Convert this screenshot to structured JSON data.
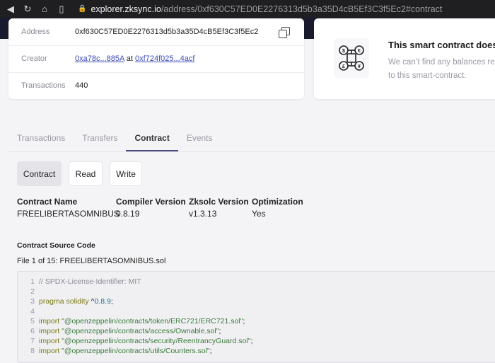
{
  "browser": {
    "url_host": "explorer.zksync.io",
    "url_path": "/address/0xf630C57ED0E2276313d5b3a35D4cB5Ef3C3f5Ec2#contract"
  },
  "info": {
    "address_label": "Address",
    "address_value": "0xf630C57ED0E2276313d5b3a35D4cB5Ef3C3f5Ec2",
    "creator_label": "Creator",
    "creator_addr": "0xa78c...885A",
    "creator_at": "at",
    "creator_tx": "0xf724f025...4acf",
    "transactions_label": "Transactions",
    "transactions_value": "440"
  },
  "balance": {
    "title": "This smart contract doesn",
    "desc_line1": "We can’t find any balances rel",
    "desc_line2": "to this smart-contract."
  },
  "tabs": [
    "Transactions",
    "Transfers",
    "Contract",
    "Events"
  ],
  "subtabs": [
    "Contract",
    "Read",
    "Write"
  ],
  "contract_info": {
    "name_label": "Contract Name",
    "name_value": "FREELIBERTASOMNIBUS",
    "compiler_label": "Compiler Version",
    "compiler_value": "0.8.19",
    "zksolc_label": "Zksolc Version",
    "zksolc_value": "v1.3.13",
    "optimization_label": "Optimization",
    "optimization_value": "Yes"
  },
  "source": {
    "title": "Contract Source Code",
    "file_info": "File 1 of 15: FREELIBERTASOMNIBUS.sol",
    "lines": [
      {
        "n": "1",
        "parts": [
          {
            "t": "// SPDX-License-Identifier: MIT",
            "c": "comment"
          }
        ]
      },
      {
        "n": "2",
        "parts": []
      },
      {
        "n": "3",
        "parts": [
          {
            "t": "pragma solidity ",
            "c": "kw"
          },
          {
            "t": "^",
            "c": ""
          },
          {
            "t": "0.8.9",
            "c": "num"
          },
          {
            "t": ";",
            "c": ""
          }
        ]
      },
      {
        "n": "4",
        "parts": []
      },
      {
        "n": "5",
        "parts": [
          {
            "t": "import ",
            "c": "kw"
          },
          {
            "t": "\"@openzeppelin/contracts/token/ERC721/ERC721.sol\"",
            "c": "str"
          },
          {
            "t": ";",
            "c": ""
          }
        ]
      },
      {
        "n": "6",
        "parts": [
          {
            "t": "import ",
            "c": "kw"
          },
          {
            "t": "\"@openzeppelin/contracts/access/Ownable.sol\"",
            "c": "str"
          },
          {
            "t": ";",
            "c": ""
          }
        ]
      },
      {
        "n": "7",
        "parts": [
          {
            "t": "import ",
            "c": "kw"
          },
          {
            "t": "\"@openzeppelin/contracts/security/ReentrancyGuard.sol\"",
            "c": "str"
          },
          {
            "t": ";",
            "c": ""
          }
        ]
      },
      {
        "n": "8",
        "parts": [
          {
            "t": "import ",
            "c": "kw"
          },
          {
            "t": "\"@openzeppelin/contracts/utils/Counters.sol\"",
            "c": "str"
          },
          {
            "t": ";",
            "c": ""
          }
        ]
      }
    ]
  }
}
